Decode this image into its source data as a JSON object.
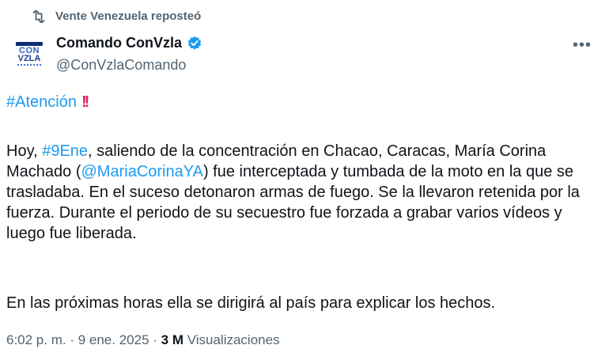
{
  "repost": {
    "label": "Vente Venezuela reposteó"
  },
  "author": {
    "name": "Comando ConVzla",
    "handle": "@ConVzlaComando",
    "avatar_line1": "CON",
    "avatar_line2": "VZLA"
  },
  "tweet": {
    "hashtag_attention": "#Atención",
    "bang": "!!",
    "p2_a": "Hoy, ",
    "p2_hashtag": "#9Ene",
    "p2_b": ", saliendo de la concentración en Chacao, Caracas, María Corina Machado (",
    "p2_mention": "@MariaCorinaYA",
    "p2_c": ") fue interceptada y tumbada de la moto en la que se trasladaba. En el suceso detonaron armas de fuego. Se la llevaron retenida por la fuerza. Durante el periodo de su secuestro fue forzada a grabar varios vídeos y luego fue liberada.",
    "p3": "En las próximas horas ella se dirigirá al país para explicar los hechos."
  },
  "meta": {
    "time": "6:02 p. m.",
    "sep": " · ",
    "date": "9 ene. 2025",
    "sep2": " · ",
    "views_count": "3 M",
    "views_label": " Visualizaciones"
  },
  "colors": {
    "link": "#1d9bf0",
    "muted": "#536471",
    "text": "#0f1419",
    "verified": "#1d9bf0"
  },
  "icons": {
    "repost": "repost-icon",
    "verified": "verified-badge-icon",
    "more": "more-options-icon"
  }
}
